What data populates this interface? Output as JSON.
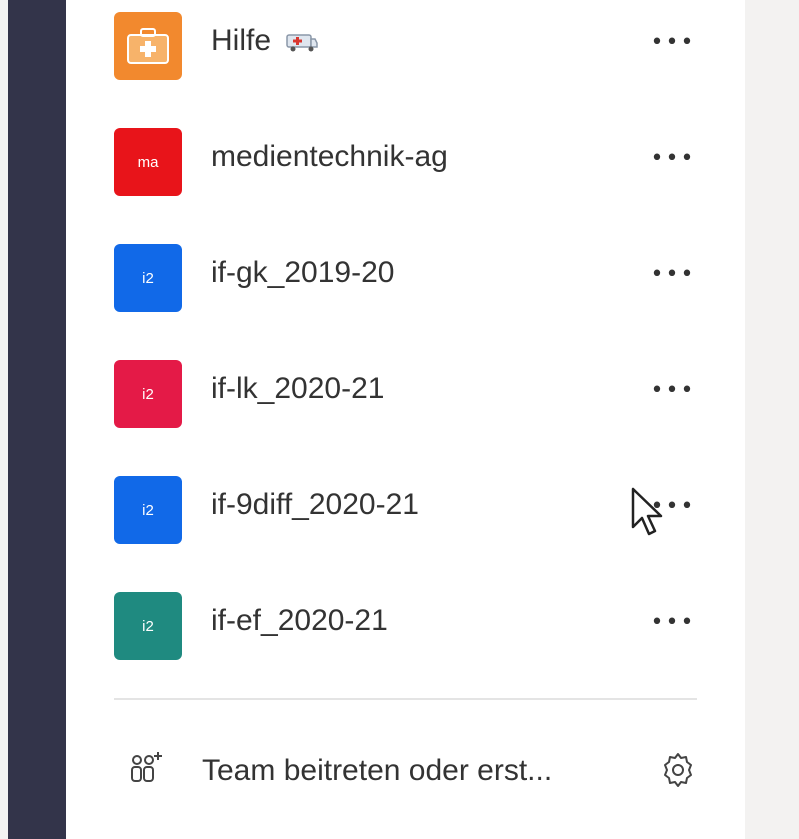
{
  "teams": [
    {
      "name": "Hilfe",
      "avatar_text": "",
      "avatar_color": "#f2892e",
      "icon": "ambulance-icon"
    },
    {
      "name": "medientechnik-ag",
      "avatar_text": "ma",
      "avatar_color": "#e8141a"
    },
    {
      "name": "if-gk_2019-20",
      "avatar_text": "i2",
      "avatar_color": "#1169e8"
    },
    {
      "name": "if-lk_2020-21",
      "avatar_text": "i2",
      "avatar_color": "#e41a47"
    },
    {
      "name": "if-9diff_2020-21",
      "avatar_text": "i2",
      "avatar_color": "#1169e8"
    },
    {
      "name": "if-ef_2020-21",
      "avatar_text": "i2",
      "avatar_color": "#1f8a80"
    }
  ],
  "more_label": "•••",
  "footer": {
    "join_label": "Team beitreten oder erst...",
    "join_icon": "add-people-icon",
    "settings_icon": "gear-icon"
  },
  "colors": {
    "rail": "#33344a",
    "panel": "#ffffff",
    "right_pane": "#f3f2f1"
  }
}
